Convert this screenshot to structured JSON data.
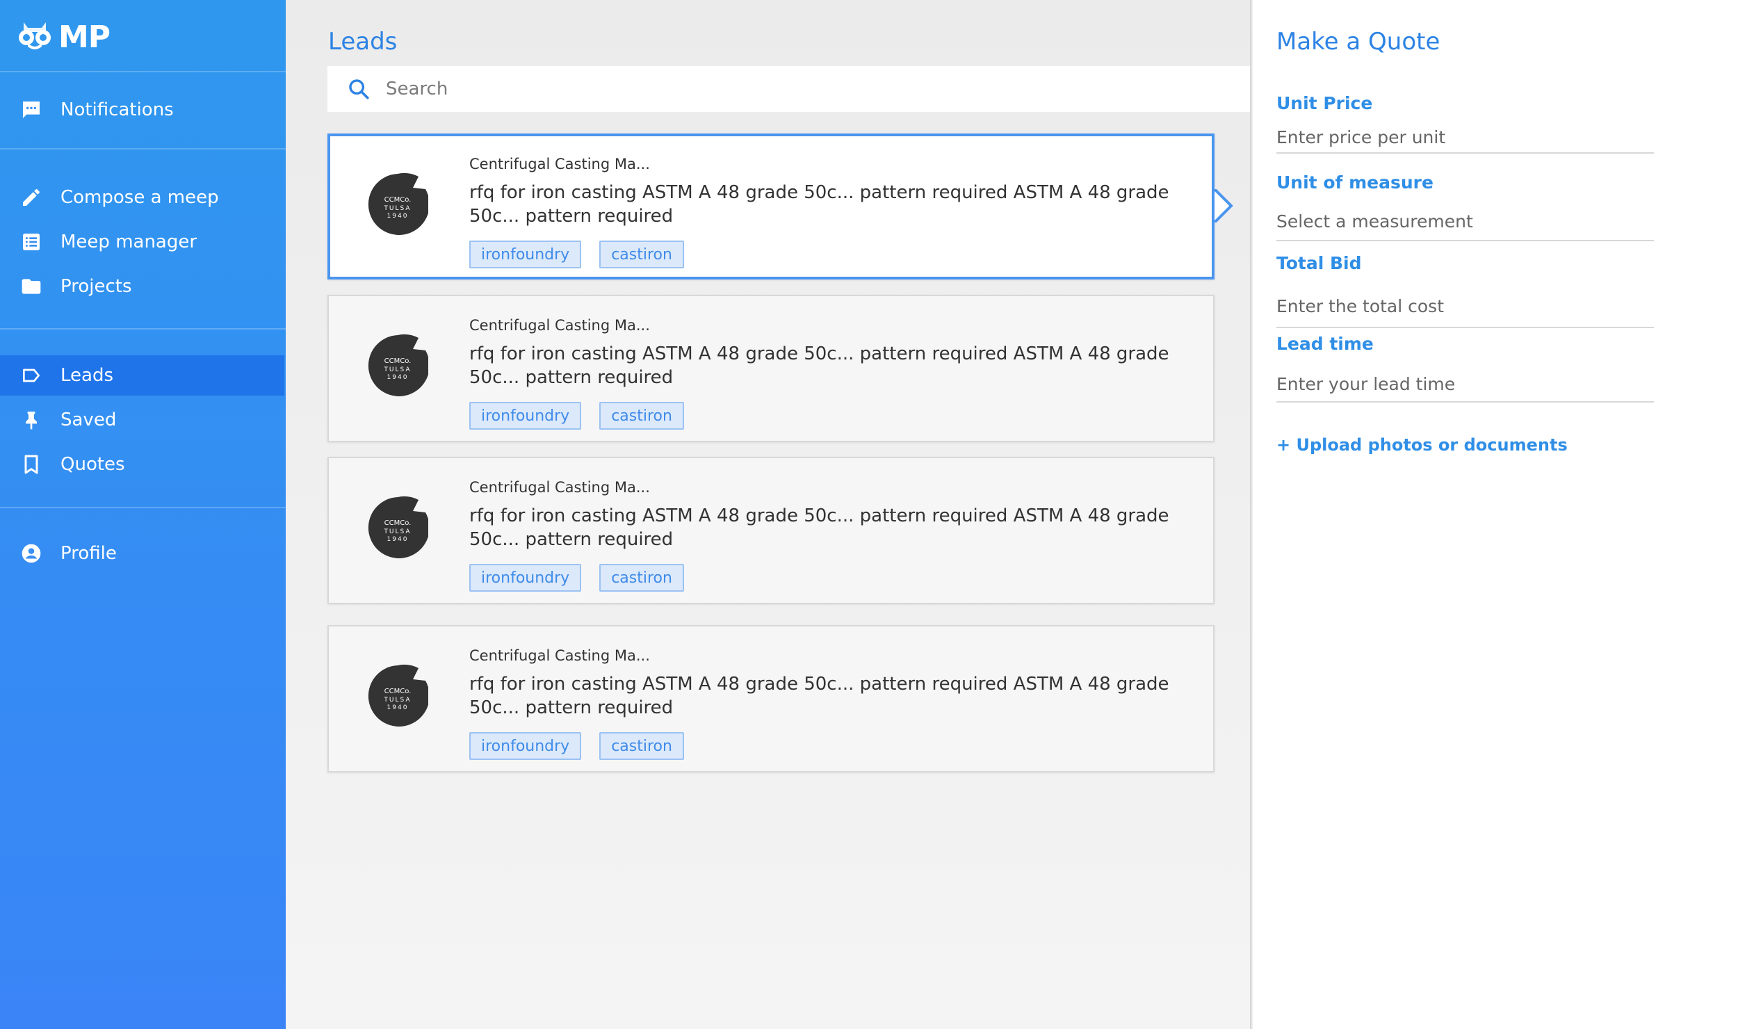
{
  "app": {
    "logo_text": "MP"
  },
  "colors": {
    "accent": "#2d83e4",
    "sidebar_top": "#2f98ee",
    "sidebar_bottom": "#3a84f7",
    "active_nav": "#1f74ea",
    "tag_bg": "#dce9fb"
  },
  "sidebar": {
    "items": [
      {
        "label": "Notifications",
        "icon": "chat-bubble-icon"
      },
      {
        "label": "Compose a meep",
        "icon": "pencil-icon"
      },
      {
        "label": "Meep manager",
        "icon": "list-icon"
      },
      {
        "label": "Projects",
        "icon": "folder-icon"
      },
      {
        "label": "Leads",
        "icon": "label-tag-icon",
        "active": true
      },
      {
        "label": "Saved",
        "icon": "pin-icon"
      },
      {
        "label": "Quotes",
        "icon": "bookmark-icon"
      },
      {
        "label": "Profile",
        "icon": "account-circle-icon"
      }
    ]
  },
  "leads": {
    "title": "Leads",
    "search": {
      "placeholder": "Search",
      "value": ""
    },
    "items": [
      {
        "company": "Centrifugal Casting Ma...",
        "avatar_text": [
          "CCMCo.",
          "TULSA",
          "1940"
        ],
        "description": "rfq for iron casting ASTM A 48 grade 50c... pattern required  ASTM A 48 grade 50c... pattern required",
        "tags": [
          "ironfoundry",
          "castiron"
        ],
        "selected": true
      },
      {
        "company": "Centrifugal Casting Ma...",
        "avatar_text": [
          "CCMCo.",
          "TULSA",
          "1940"
        ],
        "description": "rfq for iron casting ASTM A 48 grade 50c... pattern required  ASTM A 48 grade 50c... pattern required",
        "tags": [
          "ironfoundry",
          "castiron"
        ]
      },
      {
        "company": "Centrifugal Casting Ma...",
        "avatar_text": [
          "CCMCo.",
          "TULSA",
          "1940"
        ],
        "description": "rfq for iron casting ASTM A 48 grade 50c... pattern required  ASTM A 48 grade 50c... pattern required",
        "tags": [
          "ironfoundry",
          "castiron"
        ]
      },
      {
        "company": "Centrifugal Casting Ma...",
        "avatar_text": [
          "CCMCo.",
          "TULSA",
          "1940"
        ],
        "description": "rfq for iron casting ASTM A 48 grade 50c... pattern required  ASTM A 48 grade 50c... pattern required",
        "tags": [
          "ironfoundry",
          "castiron"
        ]
      }
    ]
  },
  "quote": {
    "title": "Make a Quote",
    "fields": [
      {
        "label": "Unit Price",
        "placeholder": "Enter price per unit"
      },
      {
        "label": "Unit of measure",
        "placeholder": "Select a measurement"
      },
      {
        "label": "Total Bid",
        "placeholder": "Enter the total cost"
      },
      {
        "label": "Lead time",
        "placeholder": "Enter your lead time"
      }
    ],
    "upload_label": "+ Upload photos or documents"
  }
}
